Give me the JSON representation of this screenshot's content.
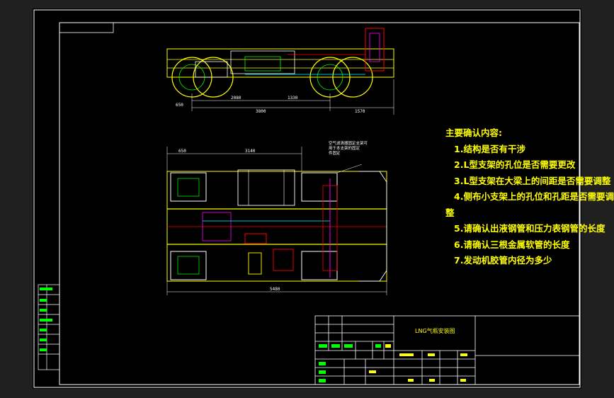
{
  "notes": {
    "heading": "主要确认内容:",
    "items": [
      "1.结构是否有干涉",
      "2.L型支架的孔位是否需要更改",
      "3.L型支架在大梁上的间距是否需要调整",
      "4.侧布小支架上的孔位和孔距是否需要调",
      "整",
      "5.请确认出液钢管和压力表钢管的长度",
      "6.请确认三根金属软管的长度",
      "7.发动机胶管内径为多少"
    ]
  },
  "dimensions": {
    "top_view": [
      "650",
      "2080",
      "1330",
      "3800",
      "1570"
    ],
    "plan_view": [
      "650",
      "3140",
      "5480"
    ]
  },
  "callout": [
    "空气滤清器固定支架可",
    "用于本支架的固定",
    "件固定"
  ],
  "title_block": {
    "drawing_title": "LNG气瓶安装图"
  },
  "colors": {
    "sheet": "#000000",
    "border": "#ffffff",
    "notes_text": "#ffff00",
    "frame_lines": "#ffff00",
    "green_lines": "#00ff00",
    "red_lines": "#ff0000",
    "magenta_lines": "#ff00ff",
    "cyan_lines": "#00ffff"
  }
}
